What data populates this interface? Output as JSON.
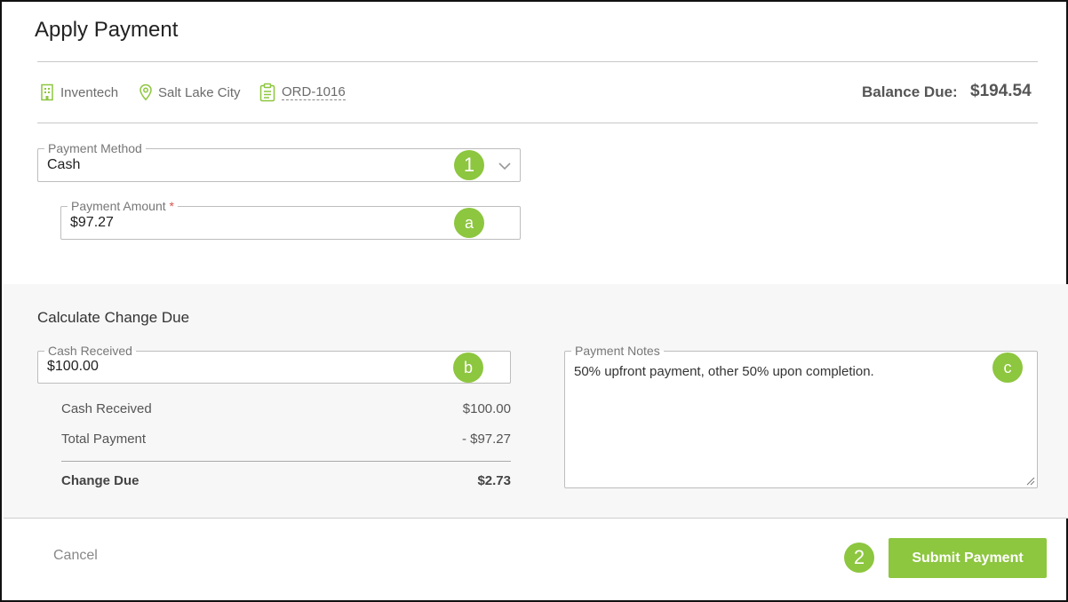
{
  "title": "Apply Payment",
  "meta": {
    "company": "Inventech",
    "city": "Salt Lake City",
    "order": "ORD-1016"
  },
  "balance": {
    "label": "Balance Due:",
    "value": "$194.54"
  },
  "payment_method": {
    "label": "Payment Method",
    "value": "Cash",
    "step": "1"
  },
  "payment_amount": {
    "label": "Payment Amount",
    "required_mark": "*",
    "value": "$97.27",
    "step": "a"
  },
  "calc": {
    "title": "Calculate Change Due",
    "cash_received_field": {
      "label": "Cash Received",
      "value": "$100.00",
      "step": "b"
    },
    "rows": [
      {
        "label": "Cash Received",
        "value": "$100.00"
      },
      {
        "label": "Total Payment",
        "value": "- $97.27"
      }
    ],
    "total": {
      "label": "Change Due",
      "value": "$2.73"
    }
  },
  "notes": {
    "label": "Payment Notes",
    "value": "50% upfront payment, other 50% upon completion.",
    "step": "c"
  },
  "footer": {
    "cancel_label": "Cancel",
    "submit_label": "Submit Payment",
    "step": "2"
  },
  "colors": {
    "accent": "#8dc63f",
    "text": "#333333",
    "muted": "#777777"
  },
  "icons": {
    "company": "building-icon",
    "city": "map-pin-icon",
    "order": "clipboard-icon",
    "dropdown": "chevron-down-icon"
  }
}
